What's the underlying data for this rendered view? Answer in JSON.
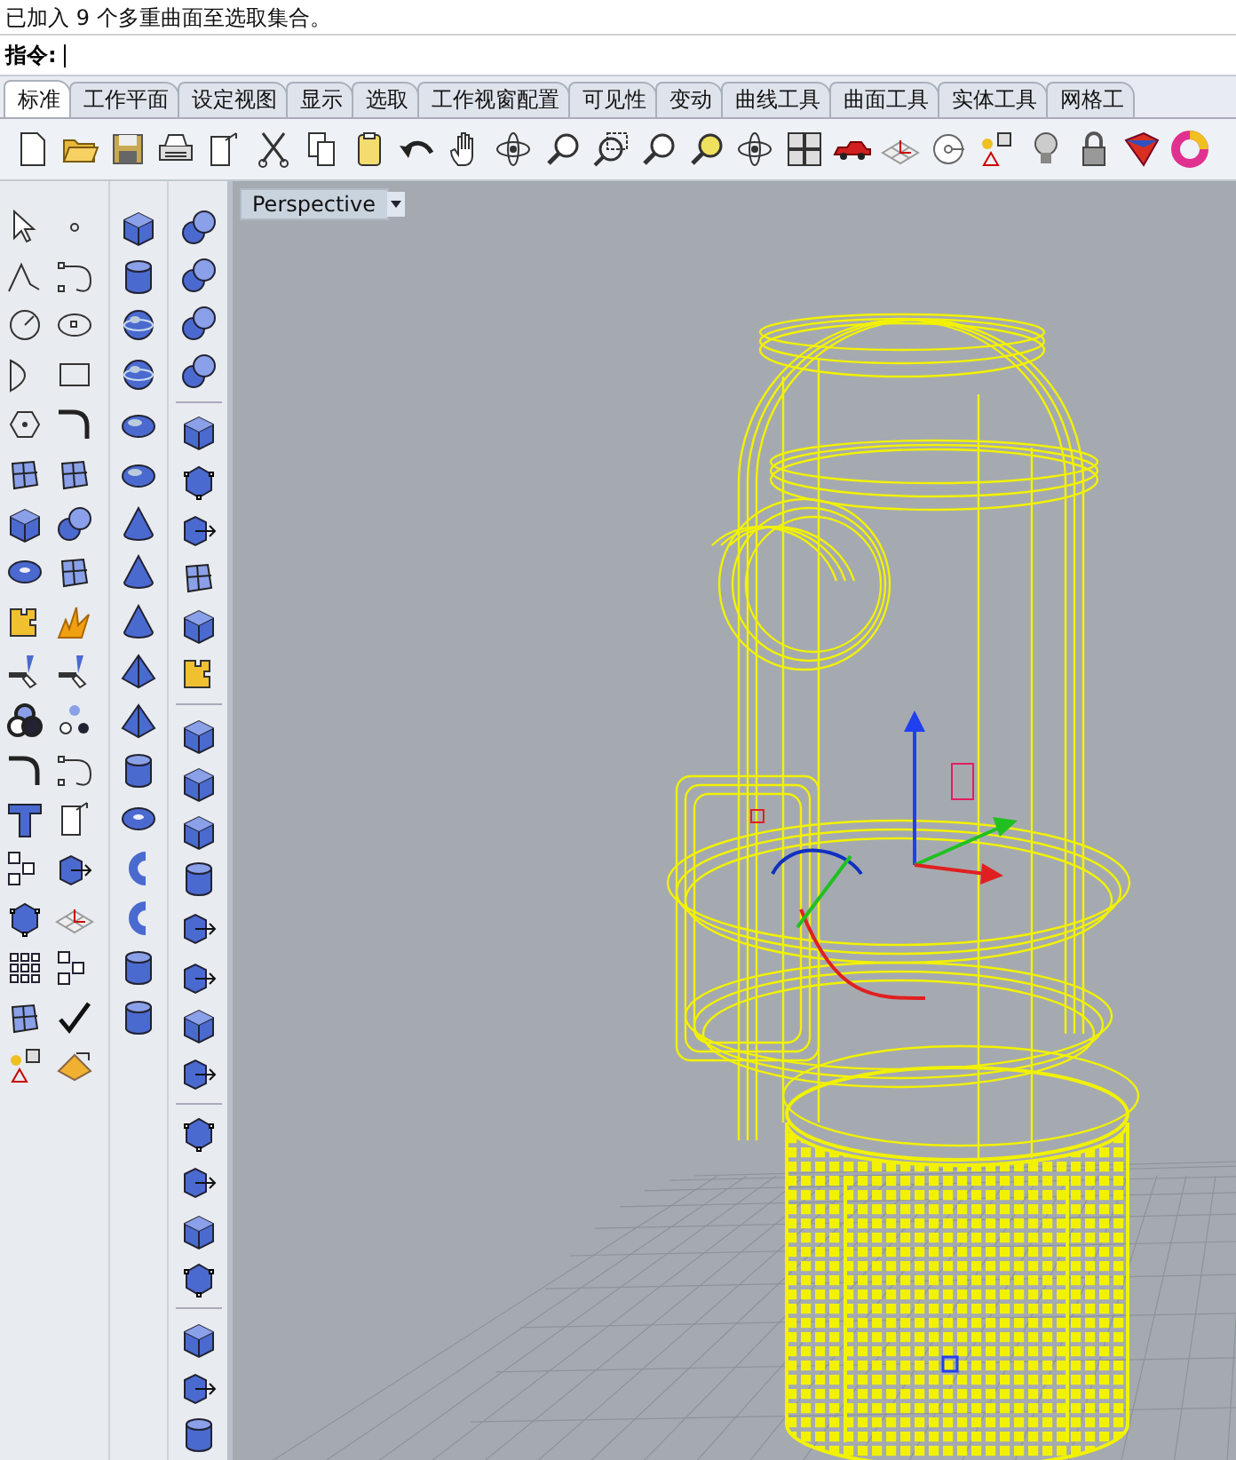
{
  "command_history": {
    "message": "已加入 9 个多重曲面至选取集合。"
  },
  "command_line": {
    "label": "指令:"
  },
  "tabs": [
    {
      "label": "标准",
      "selected": true
    },
    {
      "label": "工作平面",
      "selected": false
    },
    {
      "label": "设定视图",
      "selected": false
    },
    {
      "label": "显示",
      "selected": false
    },
    {
      "label": "选取",
      "selected": false
    },
    {
      "label": "工作视窗配置",
      "selected": false
    },
    {
      "label": "可见性",
      "selected": false
    },
    {
      "label": "变动",
      "selected": false
    },
    {
      "label": "曲线工具",
      "selected": false
    },
    {
      "label": "曲面工具",
      "selected": false
    },
    {
      "label": "实体工具",
      "selected": false
    },
    {
      "label": "网格工",
      "selected": false
    }
  ],
  "viewport": {
    "title": "Perspective"
  }
}
